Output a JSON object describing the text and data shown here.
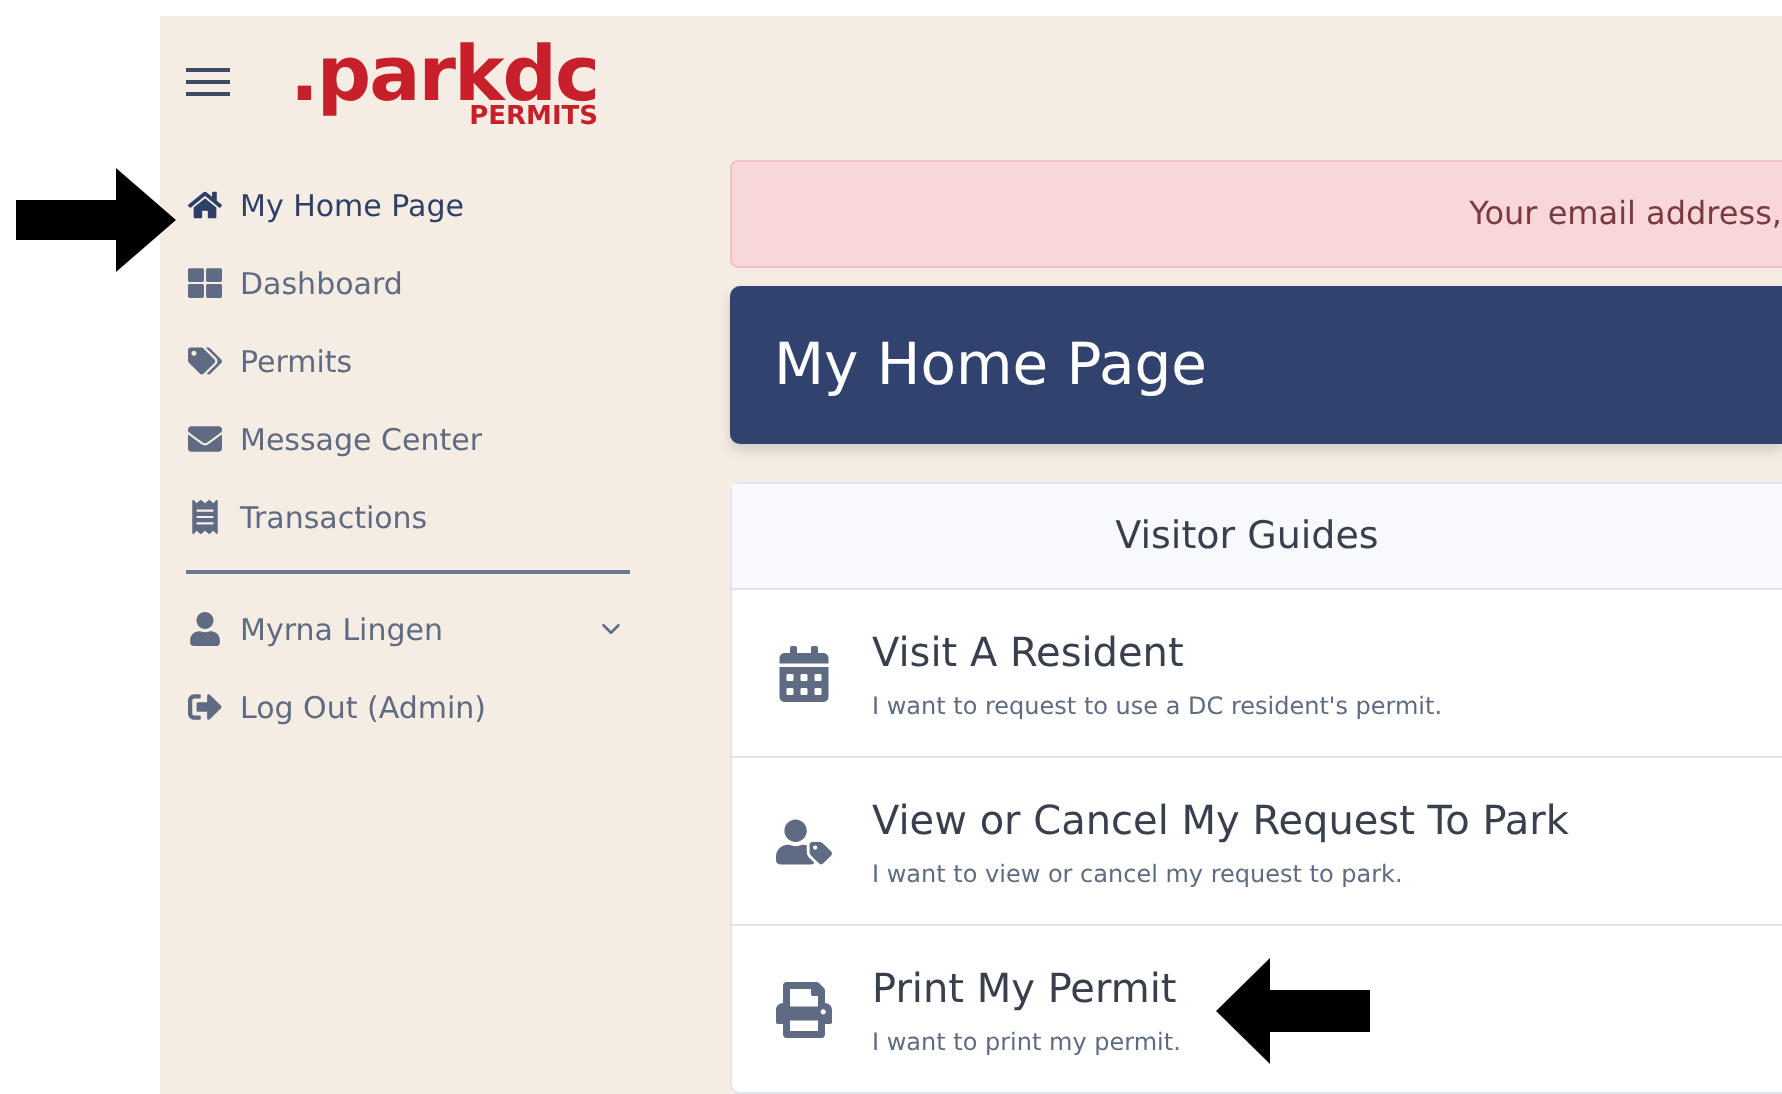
{
  "logo": {
    "wordmark": ".parkdc",
    "subtitle": "PERMITS"
  },
  "sidebar": {
    "items": [
      {
        "label": "My Home Page",
        "selected": true
      },
      {
        "label": "Dashboard",
        "selected": false
      },
      {
        "label": "Permits",
        "selected": false
      },
      {
        "label": "Message Center",
        "selected": false
      },
      {
        "label": "Transactions",
        "selected": false
      }
    ],
    "account": [
      {
        "label": "Myrna Lingen",
        "kind": "dropdown",
        "expanded": false
      },
      {
        "label": "Log Out (Admin)",
        "kind": "link"
      }
    ]
  },
  "alert": {
    "text": "Your email address,"
  },
  "page_title": "My Home Page",
  "guides": {
    "title": "Visitor Guides",
    "items": [
      {
        "title": "Visit A Resident",
        "description": "I want to request to use a DC resident's permit."
      },
      {
        "title": "View or Cancel My Request To Park",
        "description": "I want to view or cancel my request to park."
      },
      {
        "title": "Print My Permit",
        "description": "I want to print my permit."
      }
    ]
  }
}
